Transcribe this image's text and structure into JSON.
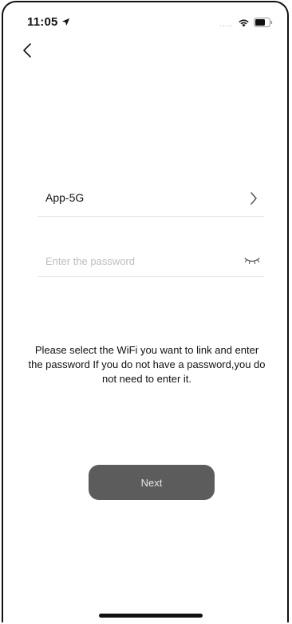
{
  "status_bar": {
    "time": "11:05",
    "location_icon": "location-arrow-icon",
    "signal_icon": "signal-dots-icon",
    "signal_text": ".....",
    "wifi_icon": "wifi-icon",
    "battery_icon": "battery-icon"
  },
  "nav": {
    "back_icon": "chevron-left-icon"
  },
  "wifi": {
    "ssid": "App-5G",
    "chevron_icon": "chevron-right-icon"
  },
  "password": {
    "value": "",
    "placeholder": "Enter the password",
    "eye_icon": "eye-closed-icon"
  },
  "hint": "Please select the WiFi you want to link and enter the password If you do not have a password,you do not need to enter it.",
  "next_button_label": "Next",
  "colors": {
    "button_bg": "#5c5c5c",
    "button_text": "#e6e6e6",
    "placeholder": "#bdbdbd",
    "divider": "#e6e6e6"
  }
}
